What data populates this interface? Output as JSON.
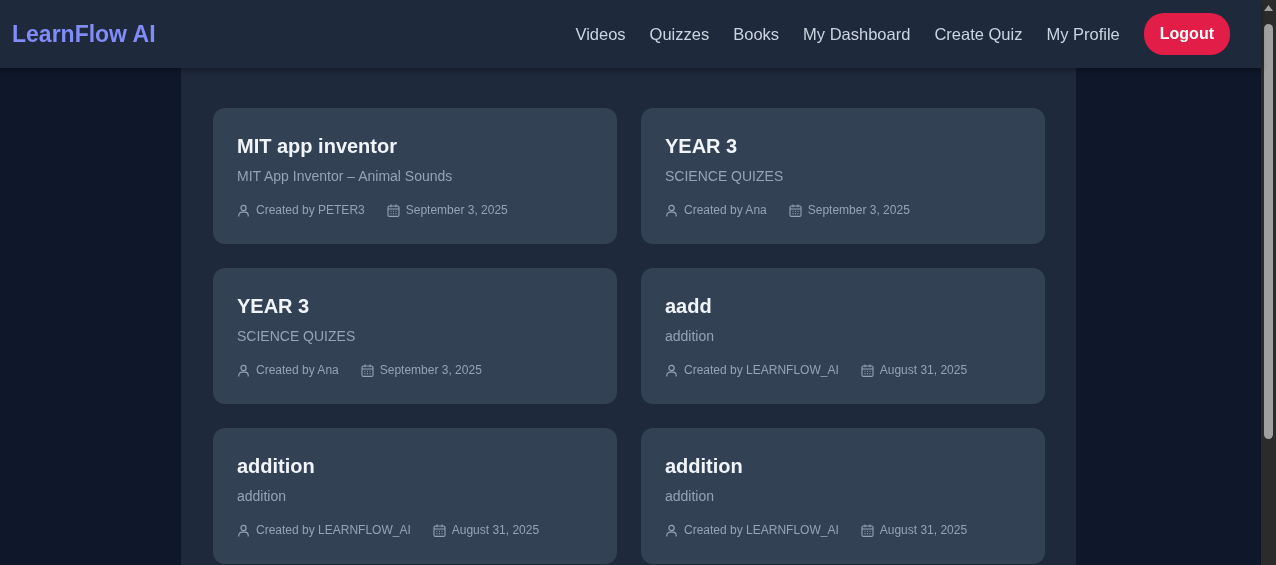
{
  "brand": "LearnFlow AI",
  "nav": [
    "Videos",
    "Quizzes",
    "Books",
    "My Dashboard",
    "Create Quiz",
    "My Profile"
  ],
  "logout": "Logout",
  "quizzes": [
    {
      "title": "MIT app inventor",
      "subtitle": "MIT App Inventor – Animal Sounds",
      "author": "Created by PETER3",
      "date": "September 3, 2025"
    },
    {
      "title": "YEAR 3",
      "subtitle": "SCIENCE QUIZES",
      "author": "Created by Ana",
      "date": "September 3, 2025"
    },
    {
      "title": "YEAR 3",
      "subtitle": "SCIENCE QUIZES",
      "author": "Created by Ana",
      "date": "September 3, 2025"
    },
    {
      "title": "aadd",
      "subtitle": "addition",
      "author": "Created by LEARNFLOW_AI",
      "date": "August 31, 2025"
    },
    {
      "title": "addition",
      "subtitle": "addition",
      "author": "Created by LEARNFLOW_AI",
      "date": "August 31, 2025"
    },
    {
      "title": "addition",
      "subtitle": "addition",
      "author": "Created by LEARNFLOW_AI",
      "date": "August 31, 2025"
    }
  ]
}
